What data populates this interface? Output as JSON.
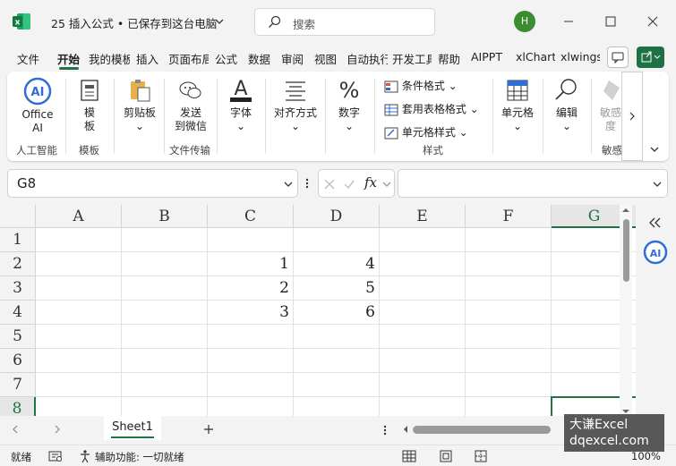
{
  "window": {
    "title": "25 插入公式 • 已保存到这台电脑",
    "search_placeholder": "搜索",
    "user_initial": "H"
  },
  "tabs": [
    {
      "label": "文件",
      "active": false
    },
    {
      "label": "开始",
      "active": true
    },
    {
      "label": "我的模板",
      "active": false
    },
    {
      "label": "插入",
      "active": false
    },
    {
      "label": "页面布局",
      "active": false
    },
    {
      "label": "公式",
      "active": false
    },
    {
      "label": "数据",
      "active": false
    },
    {
      "label": "审阅",
      "active": false
    },
    {
      "label": "视图",
      "active": false
    },
    {
      "label": "自动执行",
      "active": false
    },
    {
      "label": "开发工具",
      "active": false
    },
    {
      "label": "帮助",
      "active": false
    },
    {
      "label": "AIPPT",
      "active": false
    },
    {
      "label": "xlChart",
      "active": false
    },
    {
      "label": "xlwings",
      "active": false
    }
  ],
  "ribbon": {
    "office_ai": [
      "Office",
      "AI"
    ],
    "template": [
      "模",
      "板"
    ],
    "clipboard": "剪贴板",
    "send_wechat": [
      "发送",
      "到微信"
    ],
    "font": "字体",
    "align": "对齐方式",
    "number": "数字",
    "cond_format": "条件格式",
    "table_format": "套用表格格式",
    "cell_style": "单元格样式",
    "cells": "单元格",
    "edit": "编辑",
    "sensitivity": [
      "敏感",
      "度"
    ],
    "groups": {
      "ai": "人工智能",
      "template": "模板",
      "transfer": "文件传输",
      "styles": "样式",
      "sensitivity": "敏感"
    }
  },
  "formula_bar": {
    "name_box": "G8",
    "fx": "fx",
    "formula": ""
  },
  "grid": {
    "columns": [
      "A",
      "B",
      "C",
      "D",
      "E",
      "F",
      "G"
    ],
    "rows": [
      "1",
      "2",
      "3",
      "4",
      "5",
      "6",
      "7",
      "8"
    ],
    "selected_column": "G",
    "selected_row": "8",
    "cells": {
      "C2": "1",
      "D2": "4",
      "C3": "2",
      "D3": "5",
      "C4": "3",
      "D4": "6"
    }
  },
  "sheets": [
    {
      "label": "Sheet1",
      "active": true
    }
  ],
  "status": {
    "ready": "就绪",
    "accessibility": "辅助功能: 一切就绪",
    "zoom": "100%"
  },
  "watermark": [
    "大谦Excel",
    "dqexcel.com"
  ]
}
